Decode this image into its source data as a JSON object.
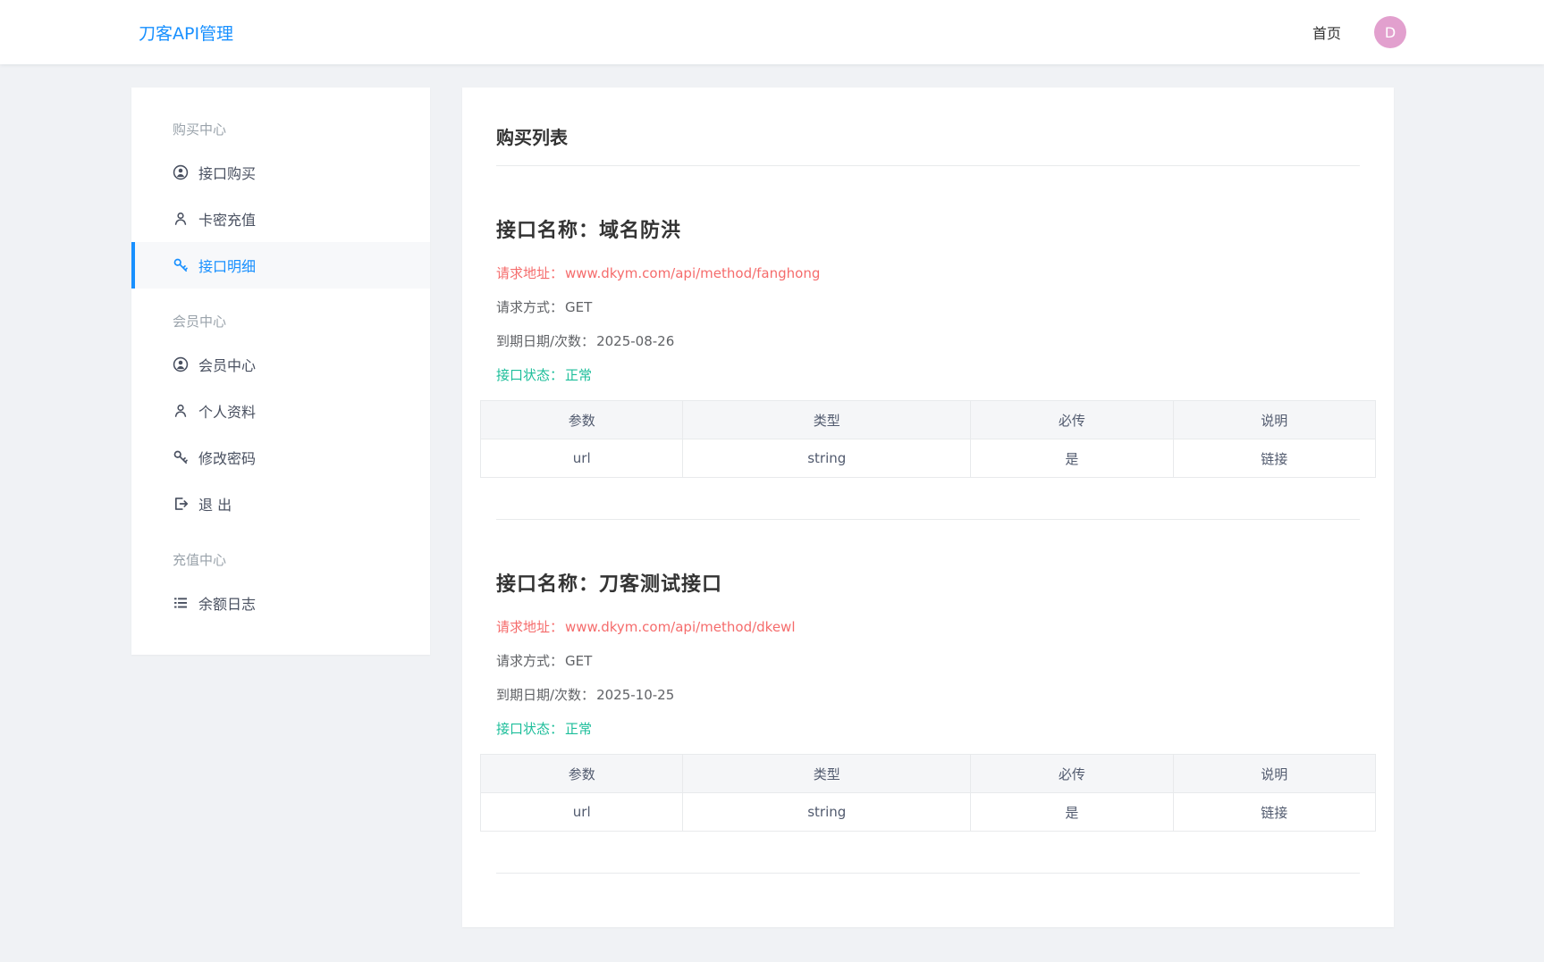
{
  "colors": {
    "primary": "#1890ff",
    "danger": "#f56c6c",
    "success": "#1cbe9a",
    "avatar_bg": "#e2a0ce",
    "page_bg": "#f0f2f5"
  },
  "header": {
    "brand": "刀客API管理",
    "nav_home": "首页",
    "avatar_letter": "D"
  },
  "sidebar": {
    "sections": [
      {
        "label": "购买中心",
        "items": [
          {
            "label": "接口购买",
            "icon": "user-circle-icon",
            "active": false
          },
          {
            "label": "卡密充值",
            "icon": "user-outline-icon",
            "active": false
          },
          {
            "label": "接口明细",
            "icon": "key-icon",
            "active": true
          }
        ]
      },
      {
        "label": "会员中心",
        "items": [
          {
            "label": "会员中心",
            "icon": "user-circle-icon",
            "active": false
          },
          {
            "label": "个人资料",
            "icon": "user-outline-icon",
            "active": false
          },
          {
            "label": "修改密码",
            "icon": "key-icon",
            "active": false
          },
          {
            "label": "退 出",
            "icon": "sign-out-icon",
            "active": false
          }
        ]
      },
      {
        "label": "充值中心",
        "items": [
          {
            "label": "余额日志",
            "icon": "list-icon",
            "active": false
          }
        ]
      }
    ]
  },
  "main": {
    "title": "购买列表",
    "apis": [
      {
        "name_label": "接口名称：",
        "name": "域名防洪",
        "url_label": "请求地址：",
        "url": "www.dkym.com/api/method/fanghong",
        "method_label": "请求方式：",
        "method": "GET",
        "expire_label": "到期日期/次数：",
        "expire": "2025-08-26",
        "status_label": "接口状态：",
        "status": "正常",
        "table": {
          "headers": [
            "参数",
            "类型",
            "必传",
            "说明"
          ],
          "rows": [
            [
              "url",
              "string",
              "是",
              "链接"
            ]
          ]
        }
      },
      {
        "name_label": "接口名称：",
        "name": "刀客测试接口",
        "url_label": "请求地址：",
        "url": "www.dkym.com/api/method/dkewl",
        "method_label": "请求方式：",
        "method": "GET",
        "expire_label": "到期日期/次数：",
        "expire": "2025-10-25",
        "status_label": "接口状态：",
        "status": "正常",
        "table": {
          "headers": [
            "参数",
            "类型",
            "必传",
            "说明"
          ],
          "rows": [
            [
              "url",
              "string",
              "是",
              "链接"
            ]
          ]
        }
      }
    ]
  }
}
